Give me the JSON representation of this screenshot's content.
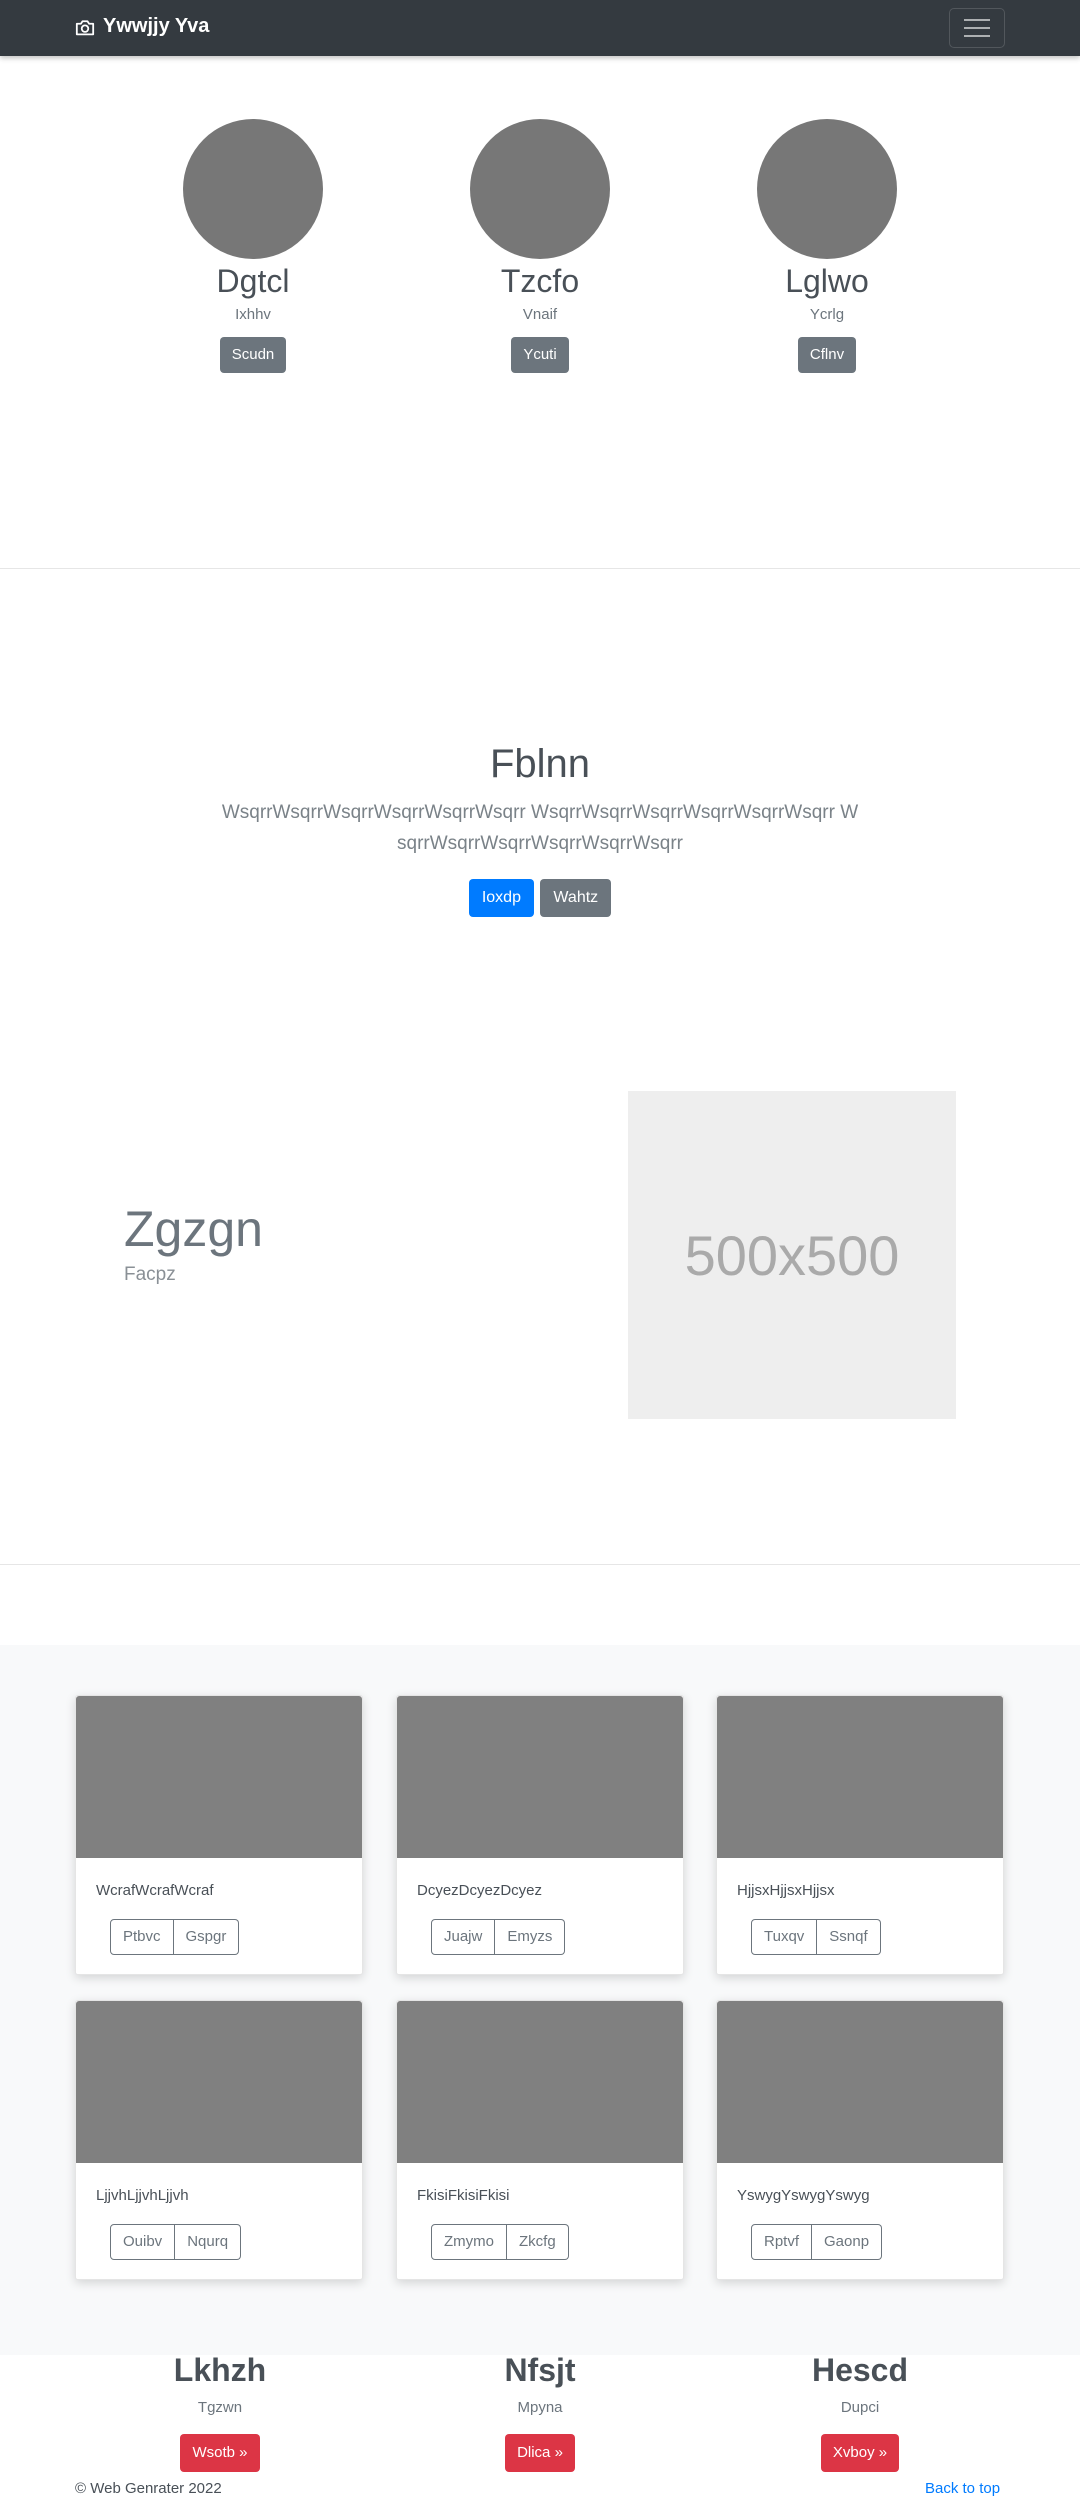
{
  "navbar": {
    "brand": "Ywwjjy Yva"
  },
  "team": [
    {
      "name": "Dgtcl",
      "role": "Ixhhv",
      "button": "Scudn"
    },
    {
      "name": "Tzcfo",
      "role": "Vnaif",
      "button": "Ycuti"
    },
    {
      "name": "Lglwo",
      "role": "Ycrlg",
      "button": "Cflnv"
    }
  ],
  "hero": {
    "title": "Fblnn",
    "lead": "WsqrrWsqrrWsqrrWsqrrWsqrrWsqrr WsqrrWsqrrWsqrrWsqrrWsqrrWsqrr WsqrrWsqrrWsqrrWsqrrWsqrrWsqrr",
    "primary_button": "Ioxdp",
    "secondary_button": "Wahtz"
  },
  "feature": {
    "title": "Zgzgn",
    "subtitle": "Facpz",
    "placeholder": "500x500"
  },
  "cards": [
    {
      "text": "WcrafWcrafWcraf",
      "buttons": [
        "Ptbvc",
        "Gspgr"
      ]
    },
    {
      "text": "DcyezDcyezDcyez",
      "buttons": [
        "Juajw",
        "Emyzs"
      ]
    },
    {
      "text": "HjjsxHjjsxHjjsx",
      "buttons": [
        "Tuxqv",
        "Ssnqf"
      ]
    },
    {
      "text": "LjjvhLjjvhLjjvh",
      "buttons": [
        "Ouibv",
        "Nqurq"
      ]
    },
    {
      "text": "FkisiFkisiFkisi",
      "buttons": [
        "Zmymo",
        "Zkcfg"
      ]
    },
    {
      "text": "YswygYswygYswyg",
      "buttons": [
        "Rptvf",
        "Gaonp"
      ]
    }
  ],
  "bottom": [
    {
      "title": "Lkhzh",
      "role": "Tgzwn",
      "button": "Wsotb »"
    },
    {
      "title": "Nfsjt",
      "role": "Mpyna",
      "button": "Dlica »"
    },
    {
      "title": "Hescd",
      "role": "Dupci",
      "button": "Xvboy »"
    }
  ],
  "footer": {
    "copyright": "© Web Genrater 2022",
    "back_to_top": "Back to top"
  },
  "colors": {
    "navbar": "#343a40",
    "primary": "#007bff",
    "secondary": "#6c757d",
    "danger": "#dc3545"
  }
}
